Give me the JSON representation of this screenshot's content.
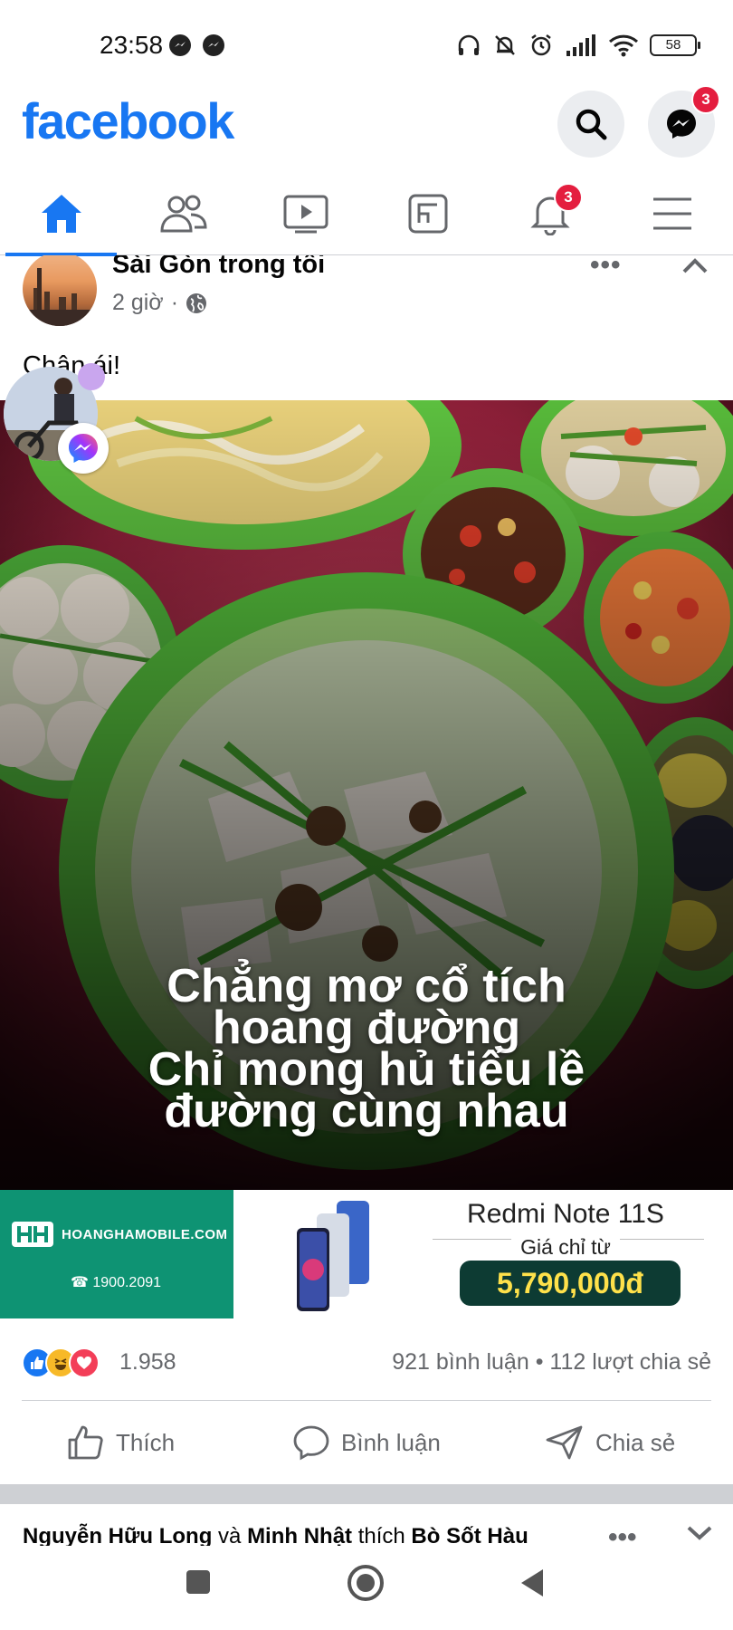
{
  "status_bar": {
    "time": "23:58",
    "battery": "58"
  },
  "app": {
    "logo": "facebook",
    "messenger_badge": "3",
    "notifications_badge": "3",
    "brand_color": "#1877f2",
    "badge_color": "#e41e3f"
  },
  "tabs": [
    {
      "name": "home",
      "icon": "home-icon",
      "active": true
    },
    {
      "name": "friends",
      "icon": "friends-icon"
    },
    {
      "name": "watch",
      "icon": "video-icon"
    },
    {
      "name": "marketplace",
      "icon": "gaming-icon"
    },
    {
      "name": "notifications",
      "icon": "bell-icon"
    },
    {
      "name": "menu",
      "icon": "hamburger-icon"
    }
  ],
  "post": {
    "page_name": "Sài Gòn trong tôi",
    "time": "2 giờ",
    "text": "Chân ái!",
    "image_caption": [
      "Chẳng mơ cổ tích",
      "hoang đường",
      "Chỉ mong hủ tiếu lề",
      "đường cùng nhau"
    ],
    "reaction_count": "1.958",
    "comments": "921 bình luận",
    "shares": "112 lượt chia sẻ",
    "actions": {
      "like": "Thích",
      "comment": "Bình luận",
      "share": "Chia sẻ"
    }
  },
  "ad": {
    "brand": "HOANGHAMOBILE.COM",
    "phone": "1900.2091",
    "product": "Redmi Note 11S",
    "price_label": "Giá chỉ từ",
    "price": "5,790,000đ",
    "brand_color": "#0e9373"
  },
  "next_post": {
    "user1": "Nguyễn Hữu Long",
    "conj": "và",
    "user2": "Minh Nhật",
    "verb": "thích",
    "page": "Bò Sốt Hàu"
  }
}
